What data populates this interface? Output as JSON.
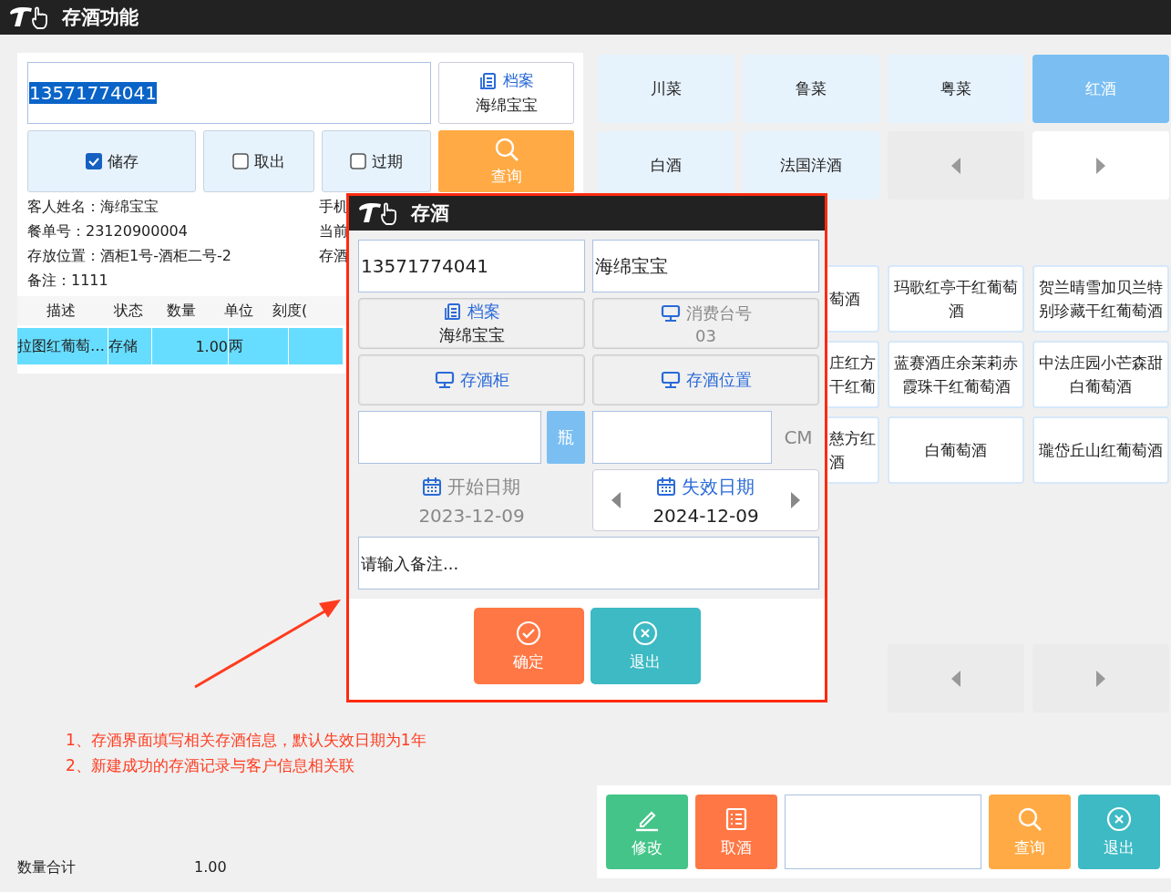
{
  "window": {
    "title": "存酒功能"
  },
  "search": {
    "value": "13571774041",
    "text_selected": true
  },
  "archive_button": {
    "label": "档案",
    "value": "海绵宝宝"
  },
  "filters": [
    {
      "label": "储存",
      "checked": true
    },
    {
      "label": "取出",
      "checked": false
    },
    {
      "label": "过期",
      "checked": false
    }
  ],
  "query_button": {
    "label": "查询"
  },
  "info": [
    {
      "label": "客人姓名：",
      "value": "海绵宝宝"
    },
    {
      "label": "餐单号：",
      "value": "23120900004"
    },
    {
      "label": "存放位置：",
      "value": "酒柜1号-酒柜二号-2"
    },
    {
      "label": "备注：",
      "value": "1111"
    }
  ],
  "info_right": [
    "手机",
    "当前",
    "存酒"
  ],
  "table": {
    "columns": [
      "描述",
      "状态",
      "数量",
      "单位",
      "刻度("
    ],
    "rows": [
      {
        "cells": [
          "拉图红葡萄…",
          "存储",
          "1.00",
          "两",
          ""
        ],
        "selected": true
      }
    ]
  },
  "categories": [
    {
      "label": "川菜",
      "selected": false
    },
    {
      "label": "鲁菜",
      "selected": false
    },
    {
      "label": "粤菜",
      "selected": false
    },
    {
      "label": "红酒",
      "selected": true
    },
    {
      "label": "白酒",
      "selected": false
    },
    {
      "label": "法国洋酒",
      "selected": false
    }
  ],
  "category_pager": {
    "prev_enabled": false,
    "next_enabled": true
  },
  "wines": [
    {
      "label": "萄酒",
      "kind": "covered"
    },
    {
      "label": "玛歌红亭干红葡萄酒",
      "kind": "full"
    },
    {
      "label": "贺兰晴雪加贝兰特别珍藏干红葡萄酒",
      "kind": "full"
    },
    {
      "label": "庄红方干红葡",
      "kind": "covered"
    },
    {
      "label": "蓝赛酒庄余茉莉赤霞珠干红葡萄酒",
      "kind": "full"
    },
    {
      "label": "中法庄园小芒森甜白葡萄酒",
      "kind": "full"
    },
    {
      "label": "慈方红酒",
      "kind": "covered"
    },
    {
      "label": "白葡萄酒",
      "kind": "full"
    },
    {
      "label": "瓏岱丘山红葡萄酒",
      "kind": "full"
    }
  ],
  "wine_pager": {
    "prev_enabled": false,
    "next_enabled": false
  },
  "notes": [
    "1、存酒界面填写相关存酒信息，默认失效日期为1年",
    "2、新建成功的存酒记录与客户信息相关联"
  ],
  "total": {
    "label": "数量合计",
    "value": "1.00"
  },
  "toolbar": [
    {
      "kind": "edit",
      "label": "修改"
    },
    {
      "kind": "list",
      "label": "取酒"
    },
    {
      "kind": "field"
    },
    {
      "kind": "search",
      "label": "查询"
    },
    {
      "kind": "exit",
      "label": "退出"
    }
  ],
  "dialog": {
    "title": "存酒",
    "phone": "13571774041",
    "name": "海绵宝宝",
    "archive": {
      "label": "档案",
      "value": "海绵宝宝"
    },
    "table_no": {
      "label": "消费台号",
      "value": "03",
      "disabled": true
    },
    "cabinet": {
      "label": "存酒柜"
    },
    "position": {
      "label": "存酒位置"
    },
    "unit": "瓶",
    "length_unit": "CM",
    "start_date": {
      "label": "开始日期",
      "value": "2023-12-09",
      "disabled": true
    },
    "end_date": {
      "label": "失效日期",
      "value": "2024-12-09",
      "disabled": false
    },
    "note_placeholder": "请输入备注...",
    "buttons": [
      {
        "kind": "ok",
        "label": "确定"
      },
      {
        "kind": "exit",
        "label": "退出"
      }
    ]
  }
}
